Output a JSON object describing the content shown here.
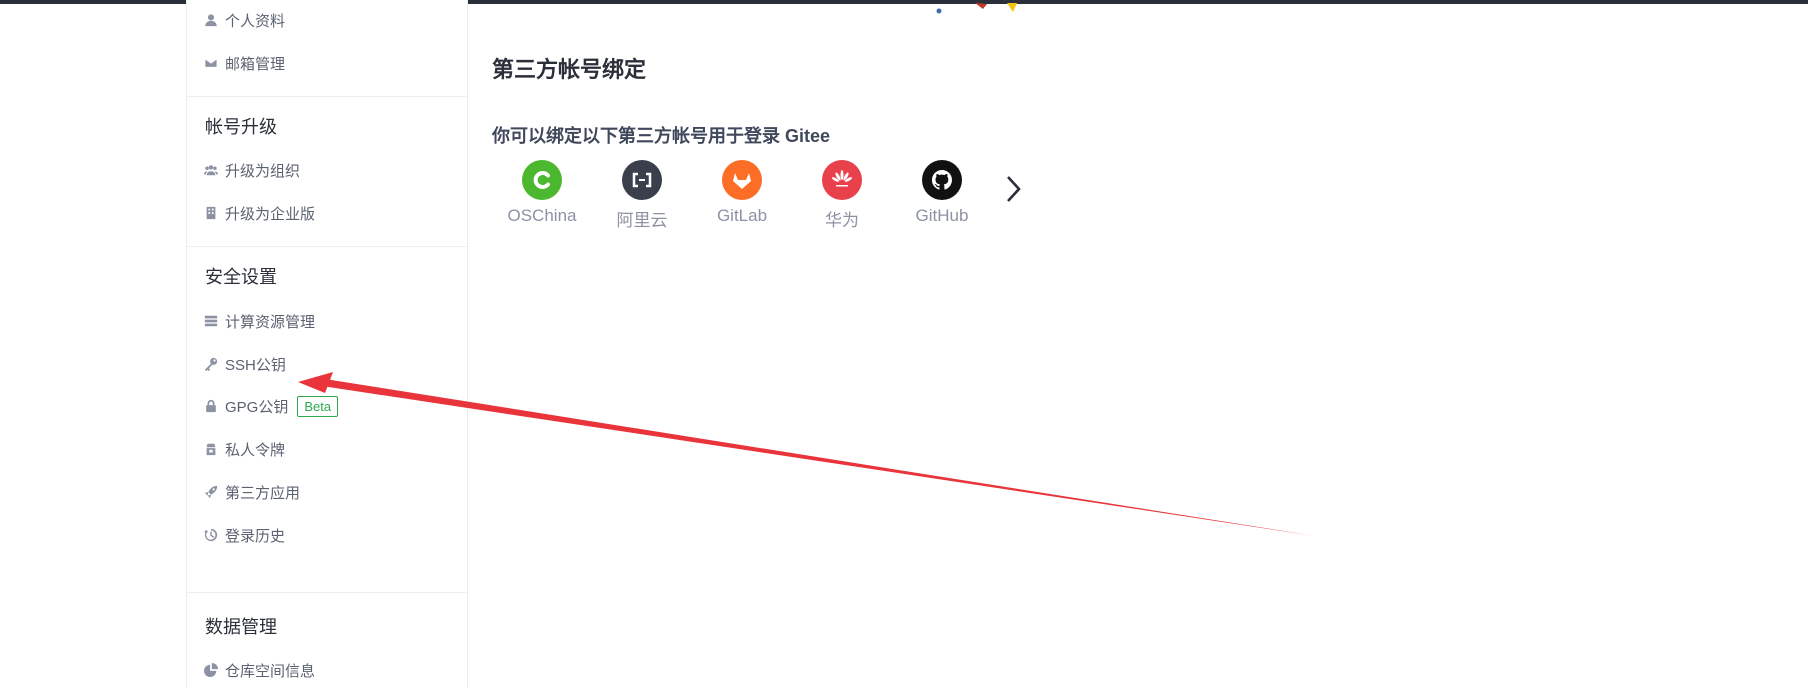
{
  "sidebar": {
    "items_top": [
      {
        "label": "个人资料",
        "icon": "user-icon"
      },
      {
        "label": "邮箱管理",
        "icon": "envelope-icon"
      }
    ],
    "groups": [
      {
        "title": "帐号升级",
        "items": [
          {
            "label": "升级为组织",
            "icon": "users-icon"
          },
          {
            "label": "升级为企业版",
            "icon": "building-icon"
          }
        ]
      },
      {
        "title": "安全设置",
        "items": [
          {
            "label": "计算资源管理",
            "icon": "server-icon"
          },
          {
            "label": "SSH公钥",
            "icon": "key-icon"
          },
          {
            "label": "GPG公钥",
            "icon": "lock-icon",
            "badge": "Beta"
          },
          {
            "label": "私人令牌",
            "icon": "token-icon"
          },
          {
            "label": "第三方应用",
            "icon": "rocket-icon"
          },
          {
            "label": "登录历史",
            "icon": "history-icon"
          }
        ]
      },
      {
        "title": "数据管理",
        "items": [
          {
            "label": "仓库空间信息",
            "icon": "pie-chart-icon"
          }
        ]
      }
    ]
  },
  "main": {
    "title": "第三方帐号绑定",
    "subtitle": "你可以绑定以下第三方帐号用于登录 Gitee",
    "providers": [
      {
        "label": "OSChina",
        "icon": "oschina-icon",
        "color": "#4bb82f"
      },
      {
        "label": "阿里云",
        "icon": "aliyun-icon",
        "color": "#3a3f4b"
      },
      {
        "label": "GitLab",
        "icon": "gitlab-icon",
        "color": "#fc6d26"
      },
      {
        "label": "华为",
        "icon": "huawei-icon",
        "color": "#e8414c"
      },
      {
        "label": "GitHub",
        "icon": "github-icon",
        "color": "#111111"
      }
    ],
    "next_icon": "chevron-right-icon"
  },
  "annotation": {
    "color": "#e8343a"
  }
}
